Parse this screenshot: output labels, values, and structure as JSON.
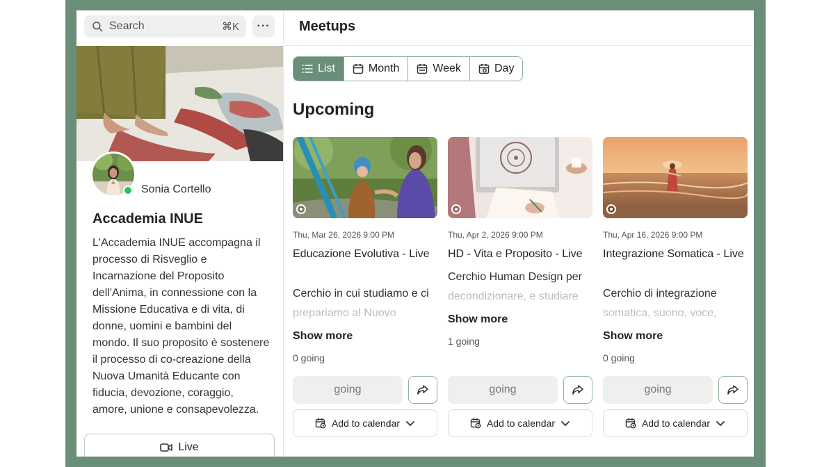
{
  "sidebar": {
    "search_placeholder": "Search",
    "search_shortcut": "⌘K",
    "more_label": "···",
    "owner_name": "Sonia Cortello",
    "org_title": "Accademia INUE",
    "org_description": "L'Accademia INUE accompagna il processo di Risveglio e Incarnazione del Proposito dell'Anima, in connessione con la Missione Educativa e di vita, di donne, uomini e bambini del mondo. Il suo proposito è sostenere il processo di co-creazione della Nuova Umanità Educante con fiducia, devozione, coraggio, amore, unione e consapevolezza.",
    "live_label": "Live"
  },
  "main": {
    "title": "Meetups",
    "views": [
      {
        "label": "List",
        "icon": "list-icon",
        "active": true
      },
      {
        "label": "Month",
        "icon": "calendar-icon",
        "active": false
      },
      {
        "label": "Week",
        "icon": "calendar-week-icon",
        "active": false
      },
      {
        "label": "Day",
        "icon": "calendar-day-icon",
        "active": false
      }
    ],
    "section_title": "Upcoming",
    "events": [
      {
        "date": "Thu, Mar 26, 2026 9:00 PM",
        "title": "Educazione Evolutiva - Live",
        "description": "Cerchio in cui studiamo e ci prepariamo al Nuovo",
        "show_more": "Show more",
        "going_count": "0 going",
        "going_label": "going",
        "calendar_label": "Add to calendar"
      },
      {
        "date": "Thu, Apr 2, 2026 9:00 PM",
        "title": "HD - Vita e Proposito - Live",
        "description": "Cerchio Human Design per decondizionare, e studiare",
        "show_more": "Show more",
        "going_count": "1 going",
        "going_label": "going",
        "calendar_label": "Add to calendar"
      },
      {
        "date": "Thu, Apr 16, 2026 9:00 PM",
        "title": "Integrazione Somatica - Live",
        "description": "Cerchio di integrazione somatica, suono, voce,",
        "show_more": "Show more",
        "going_count": "0 going",
        "going_label": "going",
        "calendar_label": "Add to calendar"
      }
    ]
  },
  "colors": {
    "accent": "#6b8e79",
    "online": "#22c55e",
    "button_bg": "#eef0ee"
  }
}
